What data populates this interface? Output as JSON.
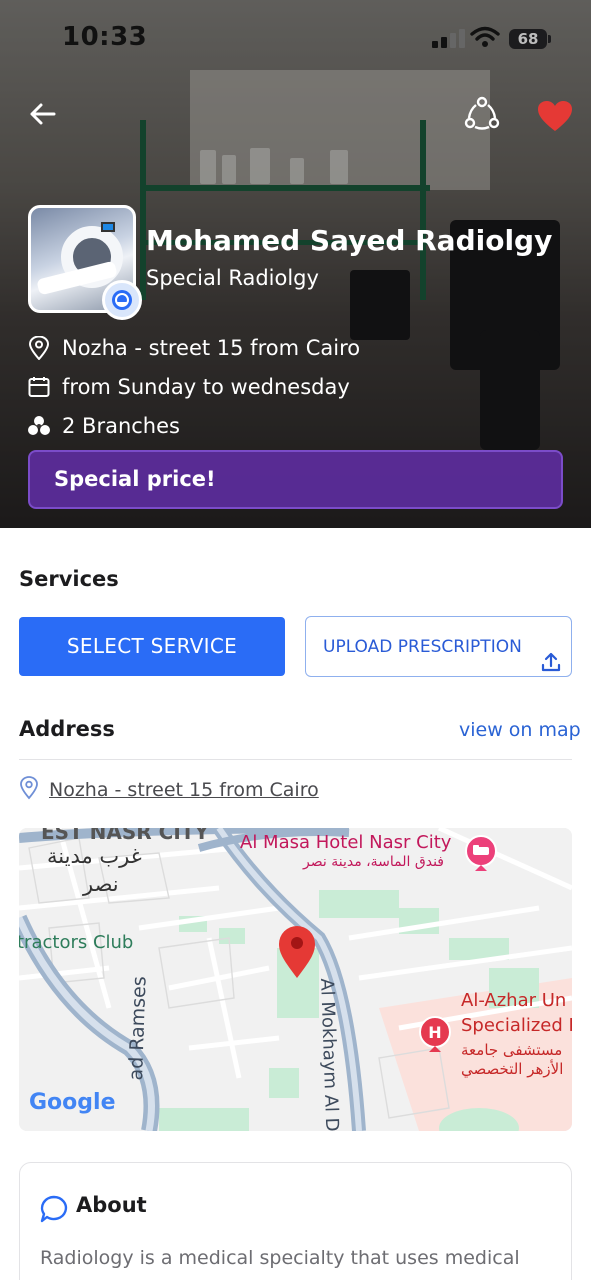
{
  "status_bar": {
    "time": "10:33",
    "battery": "68"
  },
  "provider": {
    "name": "Mohamed Sayed Radiolgy",
    "category": "Special Radiolgy",
    "location": "Nozha - street 15 from Cairo",
    "schedule": "from Sunday to wednesday",
    "branches": "2 Branches",
    "promo": "Special price!"
  },
  "services": {
    "title": "Services",
    "select_label": "SELECT SERVICE",
    "upload_label": "UPLOAD PRESCRIPTION"
  },
  "address": {
    "title": "Address",
    "map_link": "view on map",
    "value": "Nozha - street 15 from Cairo"
  },
  "map": {
    "labels": {
      "top_cut": "EST NASR CITY",
      "west_ar_1": "غرب مدينة",
      "west_ar_2": "نصر",
      "hotel_en": "Al Masa Hotel Nasr City",
      "hotel_ar": "فندق الماسة، مدينة نصر",
      "club": "tractors Club",
      "road_1": "ad Ramses",
      "road_2": "Al Mokhaym Al D",
      "hospital_en_1": "Al-Azhar Un",
      "hospital_en_2": "Specialized I",
      "hospital_ar_1": "مستشفى جامعة",
      "hospital_ar_2": "الأزهر التخصصي",
      "attribution": "Google"
    }
  },
  "about": {
    "title": "About",
    "text": "Radiology is a medical specialty that uses medical"
  },
  "colors": {
    "primary": "#2a6cf6",
    "promo": "#622ea8",
    "favorite": "#e53935",
    "link": "#2a63d4"
  },
  "icons": {
    "back": "arrow-left-icon",
    "share": "share-icon",
    "favorite": "heart-icon",
    "location": "location-pin-icon",
    "calendar": "calendar-icon",
    "branches": "branches-icon",
    "upload": "upload-icon",
    "about": "chat-bubble-icon"
  }
}
